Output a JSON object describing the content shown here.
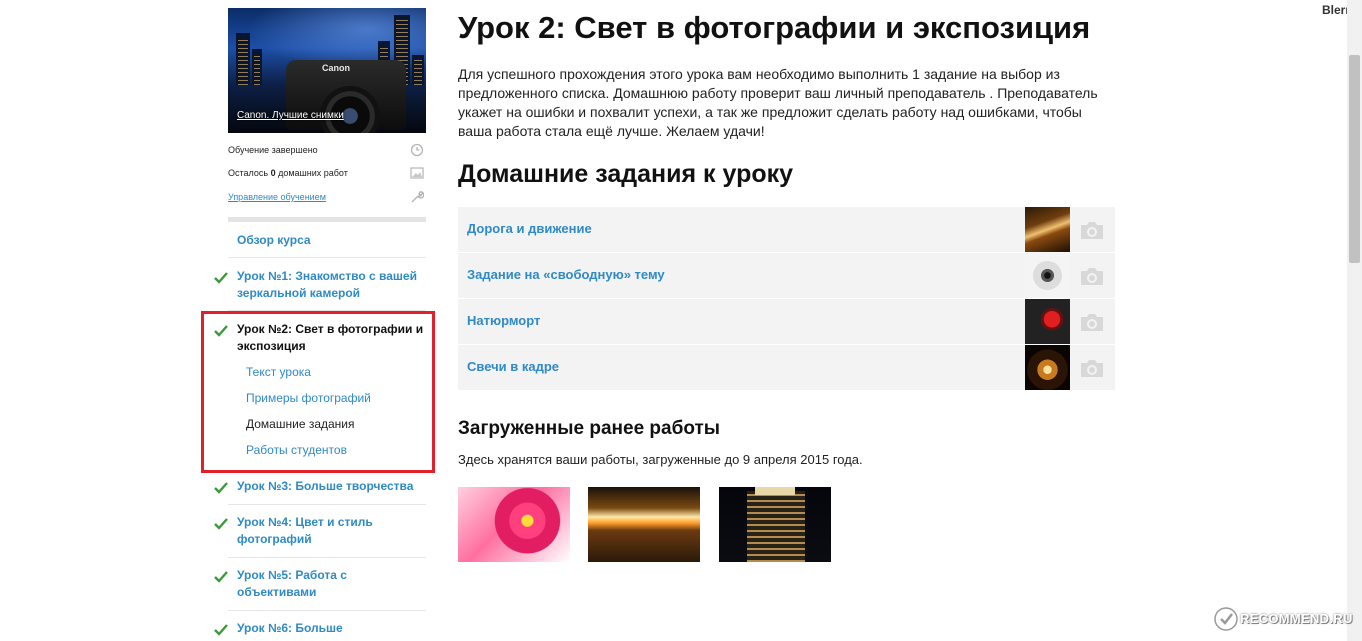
{
  "header": {
    "user": "Blerry"
  },
  "course": {
    "cover_title": "Canon. Лучшие снимки",
    "cover_brand": "Canon",
    "status": "Обучение завершено",
    "homework_left_prefix": "Осталось ",
    "homework_left_count": "0",
    "homework_left_suffix": " домашних работ",
    "manage_link": "Управление обучением"
  },
  "sidebar": {
    "overview": "Обзор курса",
    "lessons": [
      {
        "label_1": "Урок №1: Знакомство с вашей",
        "label_2": "зеркальной камерой",
        "done": true
      },
      {
        "label_1": "Урок №2: Свет в фотографии и",
        "label_2": "экспозиция",
        "done": true,
        "current": true,
        "subitems": [
          "Текст урока",
          "Примеры фотографий",
          "Домашние задания",
          "Работы студентов"
        ],
        "active_subitem": "Домашние задания"
      },
      {
        "label_1": "Урок №3: Больше творчества",
        "label_2": "",
        "done": true
      },
      {
        "label_1": "Урок №4: Цвет и стиль",
        "label_2": "фотографий",
        "done": true
      },
      {
        "label_1": "Урок №5: Работа с",
        "label_2": "объективами",
        "done": true
      },
      {
        "label_1": "Урок №6: Больше",
        "label_2": "",
        "done": true
      }
    ]
  },
  "main": {
    "title": "Урок 2: Свет в фотографии и экспозиция",
    "intro": [
      "Для успешного прохождения этого урока вам необходимо выполнить 1 задание на выбор из",
      "предложенного списка. Домашнюю работу проверит ваш личный преподаватель . Преподаватель",
      "укажет на ошибки и похвалит успехи, а так же предложит сделать работу над ошибками, чтобы",
      "ваша работа стала ещё лучше. Желаем удачи!"
    ],
    "homework_title": "Домашние задания к уроку",
    "homework": [
      {
        "title": "Дорога и движение",
        "thumb": "road-photo"
      },
      {
        "title": "Задание на «свободную» тему",
        "thumb": "lens-photo"
      },
      {
        "title": "Натюрморт",
        "thumb": "still-life-photo"
      },
      {
        "title": "Свечи в кадре",
        "thumb": "candles-photo"
      }
    ],
    "uploaded_title": "Загруженные ранее работы",
    "uploaded_note": "Здесь хранятся ваши работы, загруженные до 9 апреля 2015 года.",
    "uploaded_works": [
      "flower-photo",
      "light-trails-photo",
      "night-building-photo"
    ]
  },
  "watermark": "RECOMMEND.RU",
  "colors": {
    "link": "#2f8ac6",
    "check": "#3a9a3a",
    "highlight": "#e0202a",
    "row_bg": "#f3f3f3"
  },
  "icons": [
    "clock-icon",
    "image-icon",
    "wrench-icon",
    "check-icon",
    "camera-icon"
  ]
}
